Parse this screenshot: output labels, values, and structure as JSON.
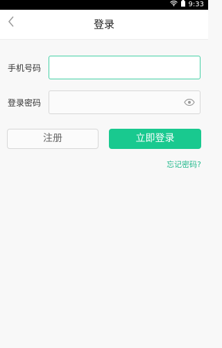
{
  "status_bar": {
    "time": "9:33",
    "icons": [
      "wifi-icon",
      "battery-icon"
    ]
  },
  "header": {
    "back_icon": "chevron-left-icon",
    "title": "登录"
  },
  "form": {
    "phone_label": "手机号码",
    "phone_value": "",
    "phone_placeholder": "",
    "password_label": "登录密码",
    "password_value": "",
    "password_placeholder": "",
    "password_visibility_icon": "eye-icon"
  },
  "actions": {
    "register_label": "注册",
    "login_label": "立即登录",
    "forgot_label": "忘记密码?"
  },
  "colors": {
    "accent": "#19c98f",
    "link": "#22b98c",
    "focus_border": "#44d0a5"
  }
}
